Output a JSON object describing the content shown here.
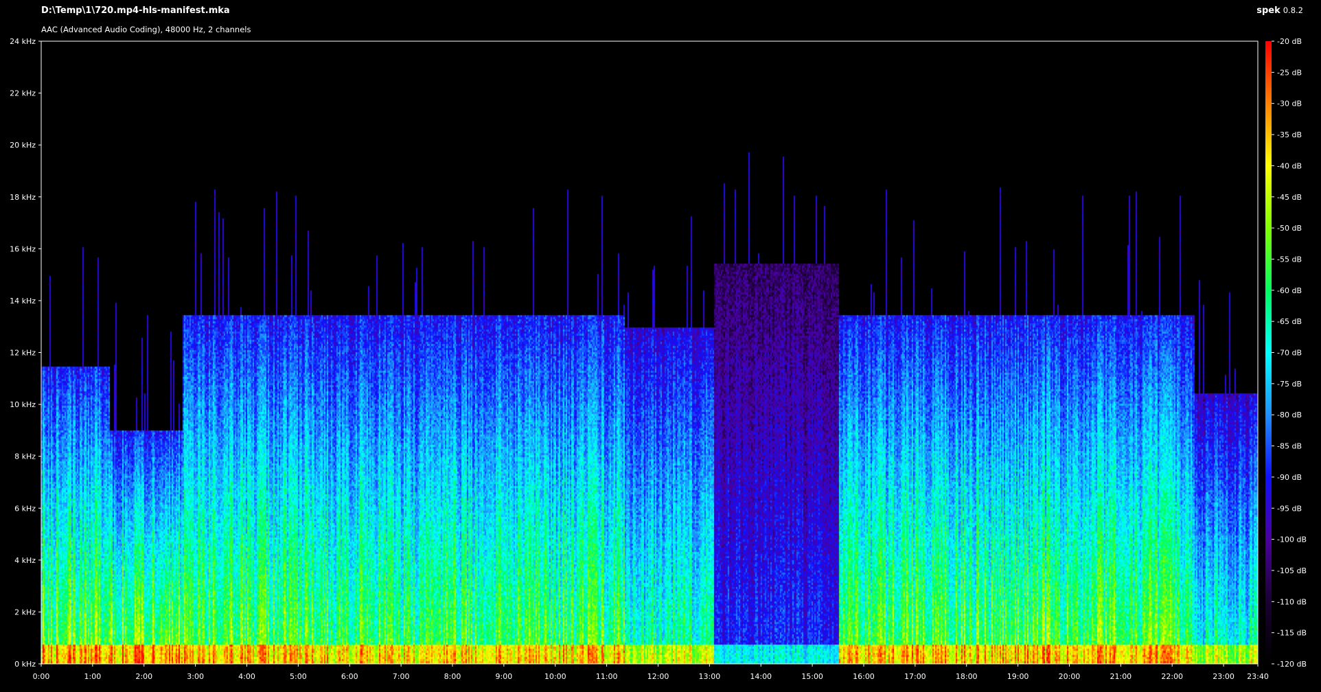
{
  "header": {
    "file_path": "D:\\Temp\\1\\720.mp4-hls-manifest.mka",
    "audio_info": "AAC (Advanced Audio Coding), 48000 Hz, 2 channels",
    "app_name": "spek",
    "app_version": "0.8.2"
  },
  "chart_data": {
    "type": "heatmap",
    "title": "",
    "xlabel": "",
    "ylabel": "",
    "x_ticks": [
      "0:00",
      "1:00",
      "2:00",
      "3:00",
      "4:00",
      "5:00",
      "6:00",
      "7:00",
      "8:00",
      "9:00",
      "10:00",
      "11:00",
      "12:00",
      "13:00",
      "14:00",
      "15:00",
      "16:00",
      "17:00",
      "18:00",
      "19:00",
      "20:00",
      "21:00",
      "22:00",
      "23:00",
      "23:40"
    ],
    "x_range_seconds": [
      0,
      1420
    ],
    "y_ticks": [
      "0 kHz",
      "2 kHz",
      "4 kHz",
      "6 kHz",
      "8 kHz",
      "10 kHz",
      "12 kHz",
      "14 kHz",
      "16 kHz",
      "18 kHz",
      "20 kHz",
      "22 kHz",
      "24 kHz"
    ],
    "y_range_khz": [
      0,
      24
    ],
    "colorbar_ticks": [
      "-20 dB",
      "-25 dB",
      "-30 dB",
      "-35 dB",
      "-40 dB",
      "-45 dB",
      "-50 dB",
      "-55 dB",
      "-60 dB",
      "-65 dB",
      "-70 dB",
      "-75 dB",
      "-80 dB",
      "-85 dB",
      "-90 dB",
      "-95 dB",
      "-100 dB",
      "-105 dB",
      "-110 dB",
      "-115 dB",
      "-120 dB"
    ],
    "colorbar_range_db": [
      -120,
      -20
    ],
    "colormap_stops": [
      "#000000",
      "#1a0033",
      "#4b00a0",
      "#1010ff",
      "#1e90ff",
      "#00ffff",
      "#00ff60",
      "#80ff00",
      "#ffff00",
      "#ff8000",
      "#ff0000"
    ],
    "segments": [
      {
        "t0": 0,
        "t1": 80,
        "lowpass_khz": 11.5,
        "level": 0.75
      },
      {
        "t0": 80,
        "t1": 165,
        "lowpass_khz": 9.0,
        "level": 0.78
      },
      {
        "t0": 165,
        "t1": 300,
        "lowpass_khz": 13.5,
        "level": 0.72
      },
      {
        "t0": 300,
        "t1": 680,
        "lowpass_khz": 13.5,
        "level": 0.7
      },
      {
        "t0": 680,
        "t1": 785,
        "lowpass_khz": 13.0,
        "level": 0.62
      },
      {
        "t0": 785,
        "t1": 930,
        "lowpass_khz": 15.5,
        "level": 0.35
      },
      {
        "t0": 930,
        "t1": 1345,
        "lowpass_khz": 13.5,
        "level": 0.72
      },
      {
        "t0": 1345,
        "t1": 1420,
        "lowpass_khz": 10.5,
        "level": 0.6
      }
    ]
  }
}
